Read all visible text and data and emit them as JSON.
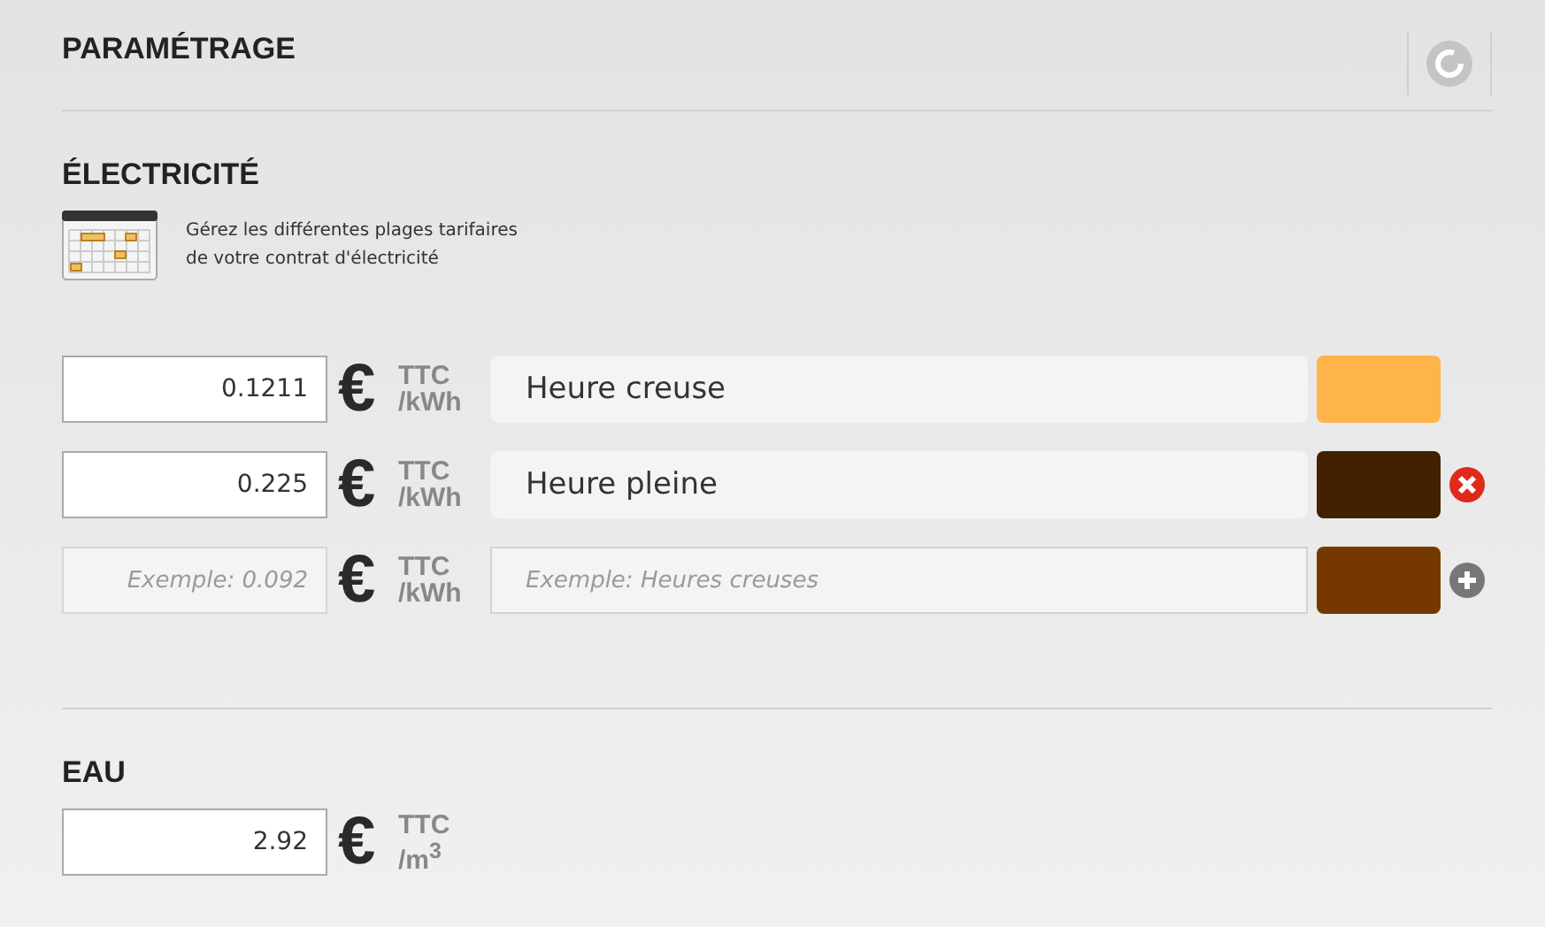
{
  "title": "PARAMÉTRAGE",
  "electricity": {
    "heading": "ÉLECTRICITÉ",
    "description": [
      "Gérez les différentes plages tarifaires",
      "de votre contrat d'électricité"
    ],
    "rates": [
      {
        "kind": "filled",
        "price": "0.1211",
        "currency": "€",
        "tax": "TTC",
        "unit": "/kWh",
        "label": "Heure creuse",
        "color": "#ffb449"
      },
      {
        "kind": "filled",
        "price": "0.225",
        "currency": "€",
        "tax": "TTC",
        "unit": "/kWh",
        "label": "Heure pleine",
        "color": "#432000",
        "removable": true
      },
      {
        "kind": "new",
        "price_placeholder": "Exemple: 0.092",
        "currency": "€",
        "tax": "TTC",
        "unit": "/kWh",
        "label_placeholder": "Exemple: Heures creuses",
        "color": "#753900",
        "addable": true
      }
    ]
  },
  "water": {
    "heading": "EAU",
    "price": "2.92",
    "currency": "€",
    "tax": "TTC",
    "unit": "/m$^{3}$"
  }
}
